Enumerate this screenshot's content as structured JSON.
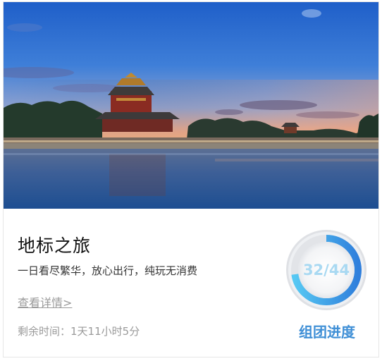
{
  "card": {
    "title": "地标之旅",
    "subtitle": "一日看尽繁华，放心出行，纯玩无消费",
    "detail_link": "查看详情>",
    "remaining_label": "剩余时间：",
    "remaining_value": "1天11小时5分"
  },
  "progress": {
    "current": 32,
    "total": 44,
    "display": "32/44",
    "fraction": 0.727,
    "label": "组团进度",
    "ring_color": "#2f8fe0",
    "label_color": "#3f8fd6"
  },
  "hero_image": {
    "subject": "forbidden-city-corner-tower-at-dusk"
  }
}
